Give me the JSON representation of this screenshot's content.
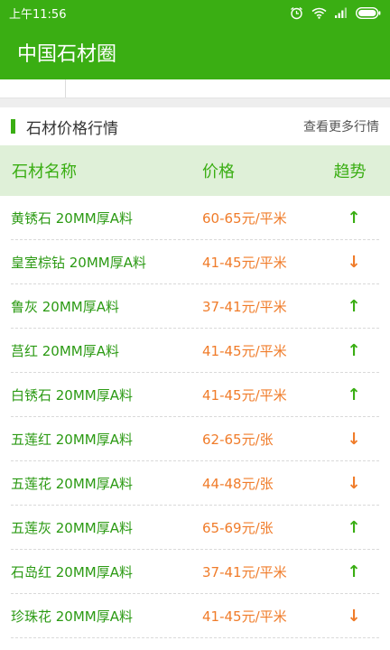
{
  "status": {
    "time": "上午11:56"
  },
  "app": {
    "title": "中国石材圈"
  },
  "section": {
    "title": "石材价格行情",
    "more": "查看更多行情"
  },
  "table": {
    "headers": [
      "石材名称",
      "价格",
      "趋势"
    ],
    "rows": [
      {
        "name": "黄锈石 20MM厚A料",
        "price": "60-65元/平米",
        "trend": "up",
        "arrow": "↑"
      },
      {
        "name": "皇室棕钻 20MM厚A料",
        "price": "41-45元/平米",
        "trend": "down",
        "arrow": "↓"
      },
      {
        "name": "鲁灰 20MM厚A料",
        "price": "37-41元/平米",
        "trend": "up",
        "arrow": "↑"
      },
      {
        "name": "莒红 20MM厚A料",
        "price": "41-45元/平米",
        "trend": "up",
        "arrow": "↑"
      },
      {
        "name": "白锈石 20MM厚A料",
        "price": "41-45元/平米",
        "trend": "up",
        "arrow": "↑"
      },
      {
        "name": "五莲红 20MM厚A料",
        "price": "62-65元/张",
        "trend": "down",
        "arrow": "↓"
      },
      {
        "name": "五莲花 20MM厚A料",
        "price": "44-48元/张",
        "trend": "down",
        "arrow": "↓"
      },
      {
        "name": "五莲灰 20MM厚A料",
        "price": "65-69元/张",
        "trend": "up",
        "arrow": "↑"
      },
      {
        "name": "石岛红 20MM厚A料",
        "price": "37-41元/平米",
        "trend": "up",
        "arrow": "↑"
      },
      {
        "name": "珍珠花 20MM厚A料",
        "price": "41-45元/平米",
        "trend": "down",
        "arrow": "↓"
      }
    ]
  },
  "colors": {
    "brand": "#3aae13",
    "up": "#3aae13",
    "down": "#f07c2a",
    "header_bg": "#dff0d8"
  },
  "icons": [
    "alarm-icon",
    "wifi-icon",
    "signal-icon",
    "battery-icon"
  ]
}
